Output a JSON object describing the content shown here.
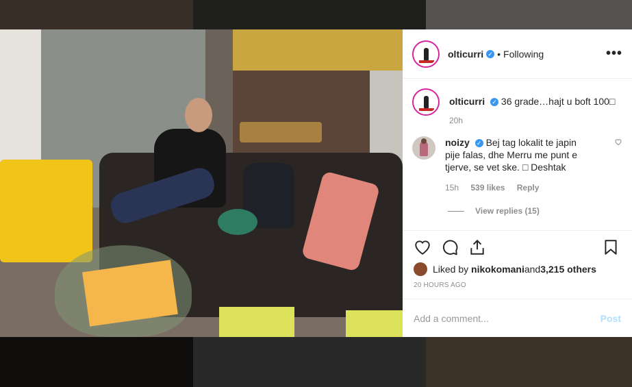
{
  "post": {
    "username": "olticurri",
    "verified_mark": "✓",
    "separator": "•",
    "follow_status": "Following",
    "more_icon": "•••",
    "caption": "36 grade…hajt u boft 100",
    "caption_emoji": "□",
    "caption_time": "20h"
  },
  "comments": [
    {
      "username": "noizy",
      "text_line1": "Bej tag lokalit te japin",
      "text_line2": "pije falas, dhe Merru me punt e",
      "text_line3": "tjerve, se vet ske. ",
      "emoji": "□",
      "text_line3_end": " Deshtak",
      "time": "15h",
      "likes": "539 likes",
      "reply": "Reply",
      "view_replies": "View replies (15)"
    }
  ],
  "likes": {
    "prefix": "Liked by ",
    "user": "nikokomani",
    "and": " and ",
    "others": "3,215 others"
  },
  "timestamp": "20 HOURS AGO",
  "add_comment": {
    "placeholder": "Add a comment...",
    "post_label": "Post"
  },
  "colors": {
    "accent": "#3897f0",
    "story_ring": "#d6249f",
    "post_disabled": "#b2dffc"
  }
}
